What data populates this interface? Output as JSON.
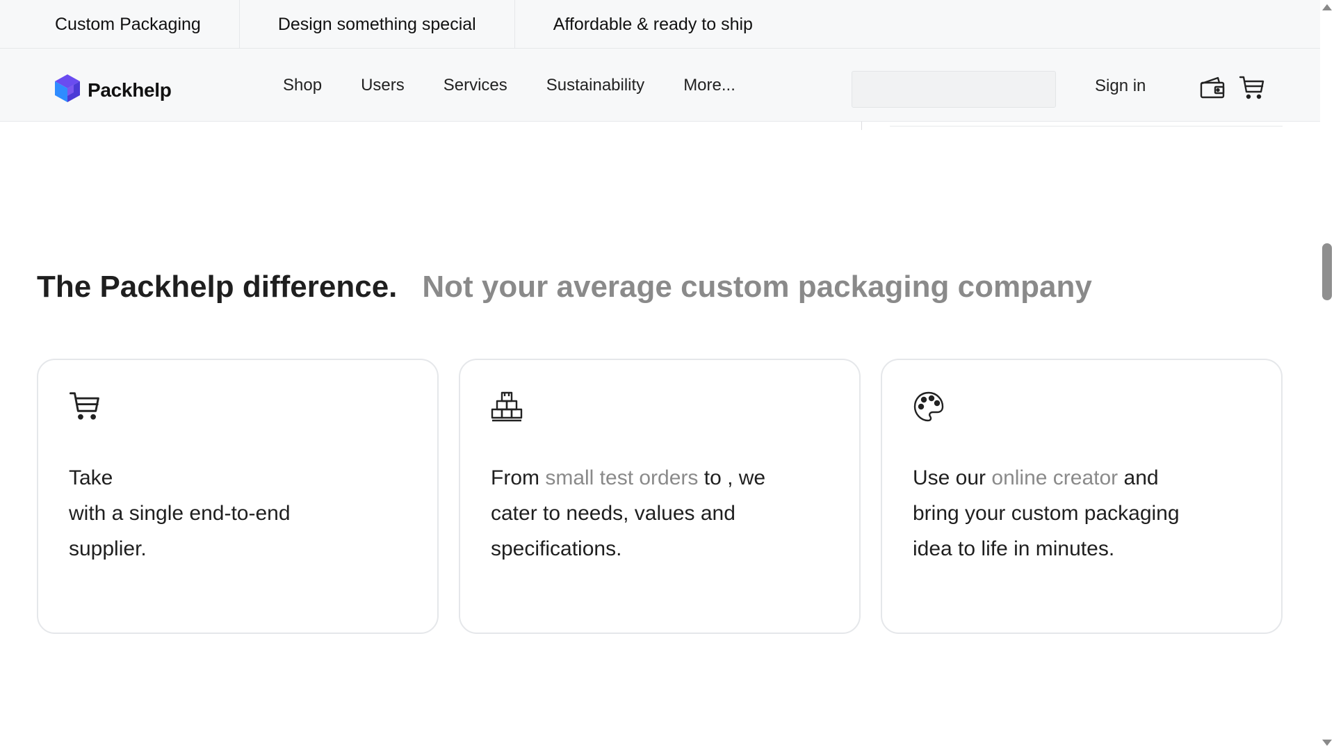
{
  "promo": {
    "items": [
      "Custom Packaging",
      "Design something special",
      "Affordable & ready to ship"
    ]
  },
  "nav": {
    "logo_text": "Packhelp",
    "links": [
      "Shop",
      "Users",
      "Services",
      "Sustainability",
      "More..."
    ],
    "search_placeholder": "",
    "sign_in": "Sign in",
    "icons": [
      "wallet-icon",
      "cart-icon"
    ]
  },
  "section": {
    "title": "The Packhelp difference.",
    "subtitle": "Not your average custom packaging company"
  },
  "cards": [
    {
      "icon": "cart-icon",
      "pre": "Take",
      "highlight": "",
      "post": "with a single end-to-end supplier."
    },
    {
      "icon": "warehouse-boxes-icon",
      "pre": "From ",
      "highlight": "small test orders",
      "post": " to , we cater to needs, values and specifications."
    },
    {
      "icon": "palette-icon",
      "pre": "Use our ",
      "highlight": "online creator",
      "post": " and bring your custom packaging idea to life in minutes."
    }
  ],
  "colors": {
    "accent_gray": "#8a8a8a",
    "header_bg": "#f7f8f9",
    "logo_blue": "#3b5bff",
    "logo_purple": "#7b3fe4"
  }
}
